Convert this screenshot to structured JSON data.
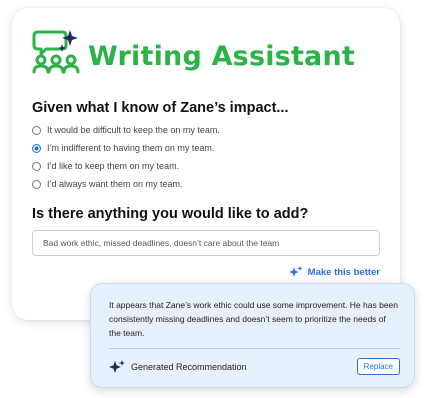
{
  "colors": {
    "brand_green": "#2bb34a",
    "accent_blue": "#2a6fe0",
    "sparkle_navy": "#1f2a5a",
    "popup_bg": "#e6f1fd"
  },
  "header": {
    "logo_icon": "team-speech-bubble-sparkle-icon",
    "title": "Writing Assistant"
  },
  "question1": {
    "label": "Given what I know of Zane’s impact...",
    "options": [
      {
        "label": "It would be difficult to keep the on my team.",
        "selected": false
      },
      {
        "label": "I’m indifferent to having them on my team.",
        "selected": true
      },
      {
        "label": "I’d like to keep them on my team.",
        "selected": false
      },
      {
        "label": "I’d always want them on my team.",
        "selected": false
      }
    ]
  },
  "question2": {
    "label": "Is there anything you would like to add?",
    "input_value": "Bad work ethic, missed deadlines, doesn’t care about the team"
  },
  "make_better": {
    "icon": "sparkle-icon",
    "label": "Make this better"
  },
  "recommendation": {
    "text": "It appears that Zane’s work ethic could use some improvement. He has been consistently missing deadlines and doesn’t seem to prioritize the needs of the team.",
    "footer_icon": "sparkle-icon",
    "footer_label": "Generated Recommendation",
    "replace_label": "Replace"
  }
}
